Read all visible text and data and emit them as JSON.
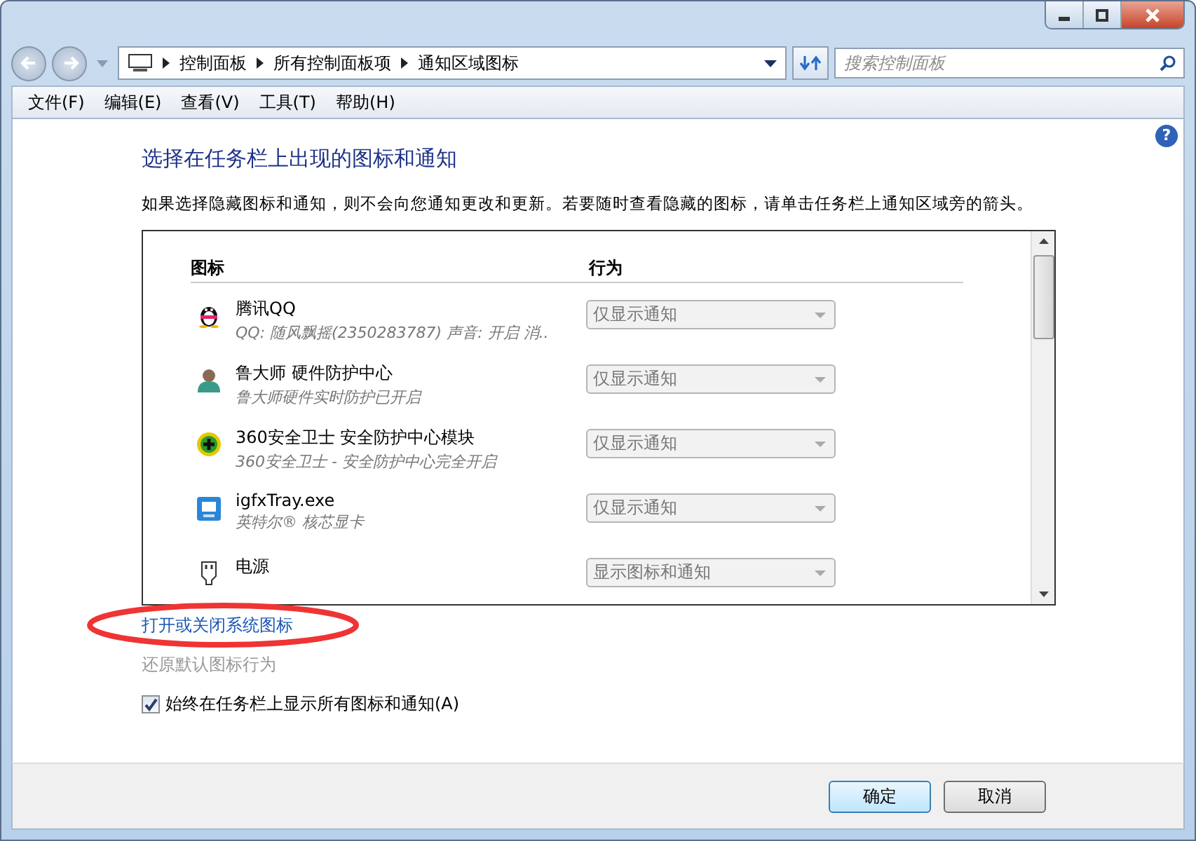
{
  "address": {
    "breadcrumb": [
      "控制面板",
      "所有控制面板项",
      "通知区域图标"
    ]
  },
  "search": {
    "placeholder": "搜索控制面板"
  },
  "help": "?",
  "menu": [
    "文件(F)",
    "编辑(E)",
    "查看(V)",
    "工具(T)",
    "帮助(H)"
  ],
  "heading": "选择在任务栏上出现的图标和通知",
  "description": "如果选择隐藏图标和通知，则不会向您通知更改和更新。若要随时查看隐藏的图标，请单击任务栏上通知区域旁的箭头。",
  "table": {
    "columns": [
      "图标",
      "行为"
    ],
    "rows": [
      {
        "kind": "penguin",
        "name": "腾讯QQ",
        "detail": "QQ: 随风飘摇(2350283787)  声音: 开启  消..",
        "behavior": "仅显示通知"
      },
      {
        "kind": "person",
        "name": "鲁大师 硬件防护中心",
        "detail": "鲁大师硬件实时防护已开启",
        "behavior": "仅显示通知"
      },
      {
        "kind": "shield",
        "name": "360安全卫士 安全防护中心模块",
        "detail": "360安全卫士 - 安全防护中心完全开启",
        "behavior": "仅显示通知"
      },
      {
        "kind": "display",
        "name": "igfxTray.exe",
        "detail": "英特尔® 核芯显卡",
        "behavior": "仅显示通知"
      },
      {
        "kind": "plug",
        "name": "电源",
        "behavior": "显示图标和通知"
      }
    ]
  },
  "links": [
    {
      "text": "打开或关闭系统图标",
      "disabled": false,
      "circled": true
    },
    {
      "text": "还原默认图标行为",
      "disabled": true,
      "circled": false
    }
  ],
  "always_show": {
    "label": "始终在任务栏上显示所有图标和通知(A)",
    "checked": true
  },
  "buttons": [
    {
      "label": "确定",
      "default": true
    },
    {
      "label": "取消",
      "default": false
    }
  ]
}
